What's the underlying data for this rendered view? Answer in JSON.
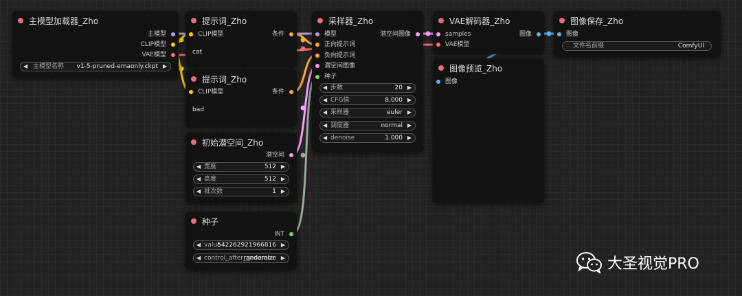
{
  "colors": {
    "title_dot": "#e86a7e",
    "model": "#b39ddb",
    "clip": "#ffd100",
    "vae": "#ff6e6e",
    "conditioning": "#ffa931",
    "latent": "#ff9cf9",
    "int": "#7bdc5f",
    "image": "#64b5f6"
  },
  "nodes": {
    "loader": {
      "title": "主模型加载器_Zho",
      "outputs": [
        "主模型",
        "CLIP模型",
        "VAE模型"
      ],
      "widget_label": "主模型名称",
      "widget_value": "v1-5-pruned-emaonly.ckpt"
    },
    "prompt_pos": {
      "title": "提示词_Zho",
      "input": "CLIP模型",
      "output": "条件",
      "text": "cat"
    },
    "prompt_neg": {
      "title": "提示词_Zho",
      "input": "CLIP模型",
      "output": "条件",
      "text": "bad"
    },
    "latent": {
      "title": "初始潜空间_Zho",
      "output": "潜空间",
      "widgets": [
        {
          "label": "宽度",
          "value": "512"
        },
        {
          "label": "高度",
          "value": "512"
        },
        {
          "label": "批次数",
          "value": "1"
        }
      ]
    },
    "seed": {
      "title": "种子",
      "output": "INT",
      "widgets": [
        {
          "label": "value",
          "value": "542262921966816"
        },
        {
          "label": "control_after_generate",
          "value": "randomize"
        }
      ]
    },
    "sampler": {
      "title": "采样器_Zho",
      "inputs": [
        "模型",
        "正向提示词",
        "负向提示词",
        "潜空间图像",
        "种子"
      ],
      "output": "潜空间图像",
      "widgets": [
        {
          "label": "步数",
          "value": "20"
        },
        {
          "label": "CFG值",
          "value": "8.000"
        },
        {
          "label": "采样器",
          "value": "euler"
        },
        {
          "label": "调度器",
          "value": "normal"
        },
        {
          "label": "denoise",
          "value": "1.000"
        }
      ]
    },
    "vae_decode": {
      "title": "VAE解码器_Zho",
      "inputs": [
        "samples",
        "VAE模型"
      ],
      "output": "图像"
    },
    "preview": {
      "title": "图像预览_Zho",
      "input": "图像"
    },
    "save": {
      "title": "图像保存_Zho",
      "input": "图像",
      "widget_label": "文件名前缀",
      "widget_value": "ComfyUI"
    }
  },
  "watermark": {
    "icon": "wechat-icon",
    "text": "大圣视觉PRO"
  }
}
